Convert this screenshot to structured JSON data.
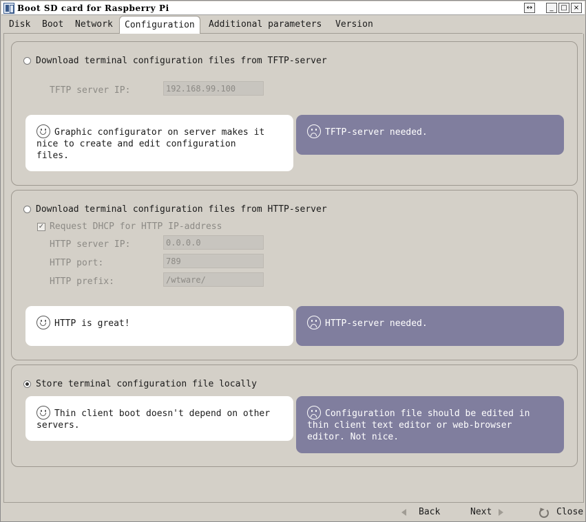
{
  "window": {
    "title": "Boot SD card for Raspberry Pi",
    "resize_label": "↔",
    "minimize_label": "_",
    "maximize_label": "□",
    "close_label": "×"
  },
  "tabs": [
    {
      "label": "Disk",
      "active": false
    },
    {
      "label": "Boot",
      "active": false
    },
    {
      "label": "Network",
      "active": false
    },
    {
      "label": "Configuration",
      "active": true
    },
    {
      "label": "Additional parameters",
      "active": false
    },
    {
      "label": "Version",
      "active": false
    }
  ],
  "tftp": {
    "option_label": "Download terminal configuration files from TFTP-server",
    "selected": false,
    "ip_label": "TFTP server IP:",
    "ip_value": "192.168.99.100",
    "pro": "Graphic configurator on server makes it\nnice to create and edit configuration\nfiles.",
    "con": "TFTP-server needed."
  },
  "http": {
    "option_label": "Download terminal configuration files from HTTP-server",
    "selected": false,
    "dhcp_label": "Request DHCP for HTTP IP-address",
    "dhcp_checked": true,
    "ip_label": "HTTP server IP:",
    "ip_value": "0.0.0.0",
    "port_label": "HTTP port:",
    "port_value": "789",
    "prefix_label": "HTTP prefix:",
    "prefix_value": "/wtware/",
    "pro": "HTTP is great!",
    "con": "HTTP-server needed."
  },
  "local": {
    "option_label": "Store terminal configuration file locally",
    "selected": true,
    "pro": "Thin client boot doesn't depend on other\nservers.",
    "con": "Configuration file should be edited in\nthin client text editor or web-browser\neditor. Not nice."
  },
  "footer": {
    "back_label": "Back",
    "next_label": "Next",
    "close_label": "Close"
  },
  "colors": {
    "background": "#d4d0c8",
    "pro_card": "#ffffff",
    "con_card": "#807e9e",
    "disabled_text": "#8c8a85"
  }
}
